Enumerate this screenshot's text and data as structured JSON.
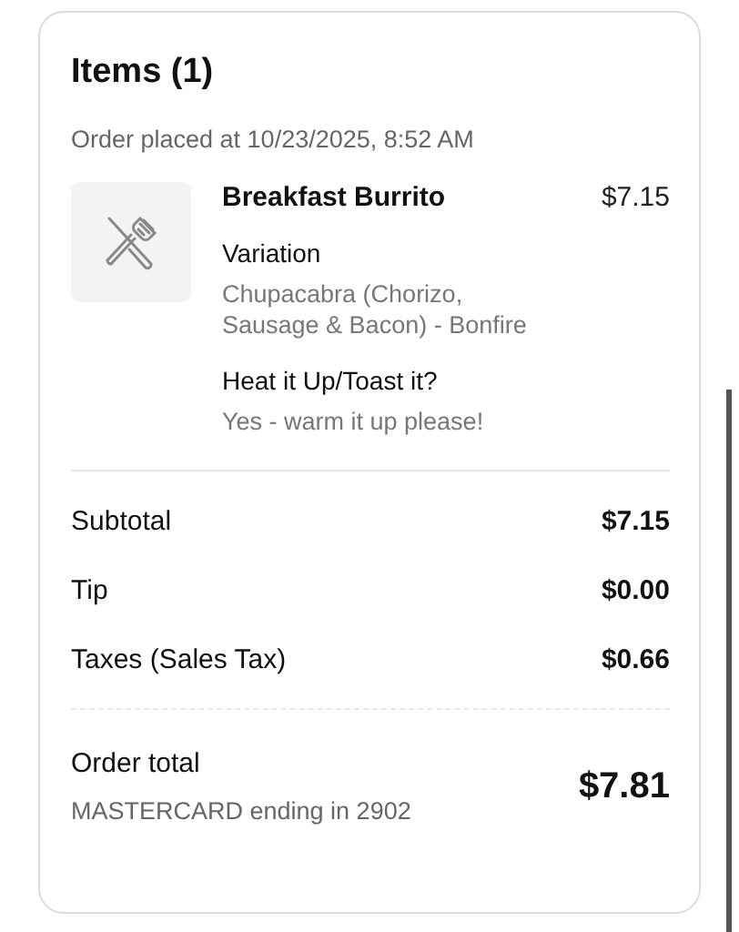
{
  "title": "Items (1)",
  "order_placed": "Order placed at 10/23/2025, 8:52 AM",
  "items": [
    {
      "name": "Breakfast Burrito",
      "price": "$7.15",
      "image": {
        "kind": "placeholder"
      },
      "modifiers": [
        {
          "label": "Variation",
          "value": "Chupacabra (Chorizo, Sausage & Bacon) - Bonfire"
        },
        {
          "label": "Heat it Up/Toast it?",
          "value": "Yes - warm it up please!"
        }
      ]
    }
  ],
  "summary": [
    {
      "label": "Subtotal",
      "amount": "$7.15"
    },
    {
      "label": "Tip",
      "amount": "$0.00"
    },
    {
      "label": "Taxes (Sales Tax)",
      "amount": "$0.66"
    }
  ],
  "total": {
    "label": "Order total",
    "payment": "MASTERCARD ending in 2902",
    "amount": "$7.81"
  }
}
